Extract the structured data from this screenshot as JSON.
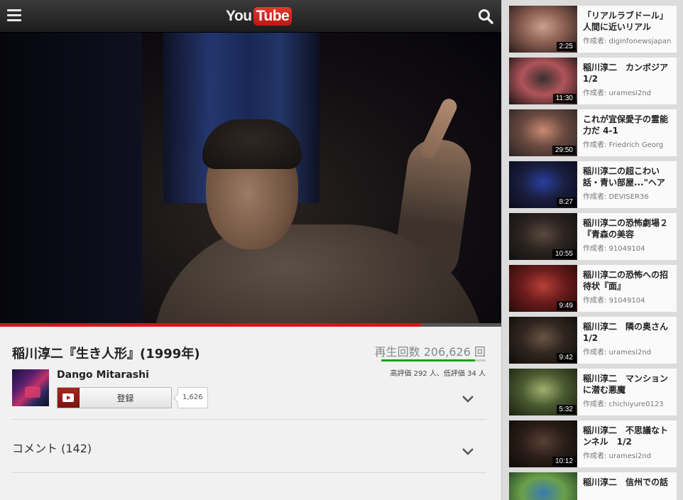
{
  "header": {
    "logo_you": "You",
    "logo_tube": "Tube"
  },
  "player": {
    "progress_fraction": 0.84
  },
  "video": {
    "title": "稲川淳二『生き人形』(1999年)",
    "views": "再生回数 206,626 回",
    "rating": "高評価 292 人、低評価 34 人",
    "like_fraction": 0.9,
    "channel": "Dango Mitarashi",
    "subscribe_label": "登録",
    "subscriber_count": "1,626",
    "comments_label": "コメント (142)"
  },
  "colors": {
    "accent": "#cc181e",
    "like_green": "#1aa31a"
  },
  "related": [
    {
      "title": "「リアルラブドール」人間に近いリアル",
      "author": "作成者: diginfonewsjapan",
      "duration": "2:25",
      "thumb": [
        "#c9a08e",
        "#8a5f52",
        "#2a1c1c"
      ]
    },
    {
      "title": "稲川淳二　カンボジア　1/2",
      "author": "作成者: uramesi2nd",
      "duration": "11:30",
      "thumb": [
        "#3a3030",
        "#b0545a",
        "#1a1414"
      ]
    },
    {
      "title": "これが宜保愛子の霊能力だ 4-1",
      "author": "作成者: Friedrich Georg",
      "duration": "29:50",
      "thumb": [
        "#c98a72",
        "#6a4a40",
        "#2c2424"
      ]
    },
    {
      "title": "稲川淳二の超こわい話・青い部屋...\"ヘア",
      "author": "作成者: DEVISER36",
      "duration": "8:27",
      "thumb": [
        "#2a3fa0",
        "#1a1f40",
        "#0a0a18"
      ]
    },
    {
      "title": "稲川淳二の恐怖劇場２　『青森の美容",
      "author": "作成者: 91049104",
      "duration": "10:55",
      "thumb": [
        "#5a4a3e",
        "#2c2420",
        "#101010"
      ]
    },
    {
      "title": "稲川淳二の恐怖への招待状『面』",
      "author": "作成者: 91049104",
      "duration": "9:49",
      "thumb": [
        "#b84038",
        "#6a1c1c",
        "#2a0808"
      ]
    },
    {
      "title": "稲川淳二　隣の奥さん　1/2",
      "author": "作成者: uramesi2nd",
      "duration": "9:42",
      "thumb": [
        "#6a5444",
        "#30261f",
        "#0e0c0a"
      ]
    },
    {
      "title": "稲川淳二　マンションに潜む悪魔",
      "author": "作成者: chichiyure0123",
      "duration": "5:32",
      "thumb": [
        "#a0b070",
        "#4a5a30",
        "#1a2010"
      ]
    },
    {
      "title": "稲川淳二　不思議なトンネル　1/2",
      "author": "作成者: uramesi2nd",
      "duration": "10:12",
      "thumb": [
        "#5a4034",
        "#2a1e18",
        "#0c0a08"
      ]
    },
    {
      "title": "稲川淳二　信州での話",
      "author": "",
      "duration": "",
      "thumb": [
        "#3a7ab0",
        "#6aa04a",
        "#203a20"
      ]
    }
  ]
}
